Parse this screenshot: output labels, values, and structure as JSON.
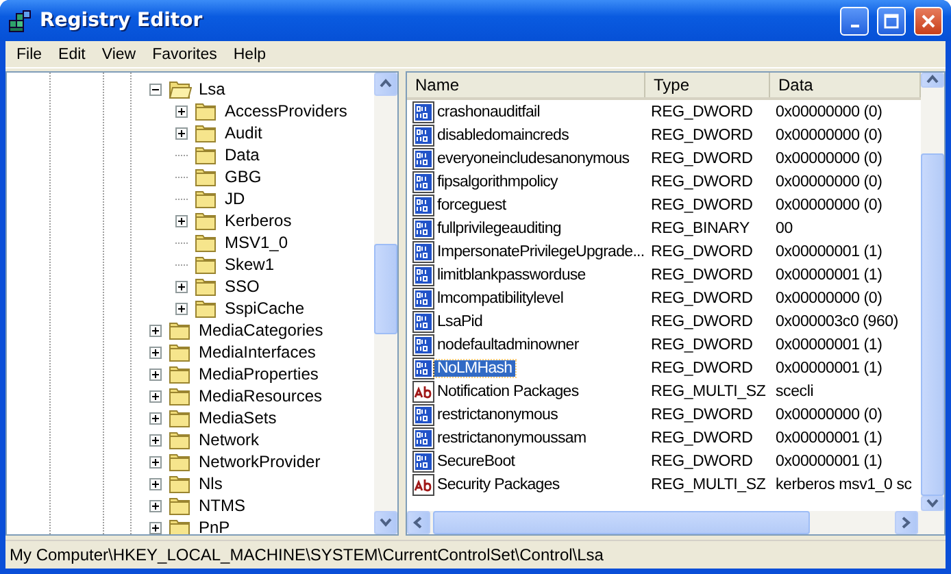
{
  "window": {
    "title": "Registry Editor"
  },
  "menu": [
    {
      "label": "File"
    },
    {
      "label": "Edit"
    },
    {
      "label": "View"
    },
    {
      "label": "Favorites"
    },
    {
      "label": "Help"
    }
  ],
  "tree": {
    "items": [
      {
        "label": "Lsa",
        "expandable": true,
        "expanded": true,
        "children": [
          {
            "label": "AccessProviders",
            "expandable": true,
            "expanded": false
          },
          {
            "label": "Audit",
            "expandable": true,
            "expanded": false
          },
          {
            "label": "Data",
            "expandable": false,
            "expanded": false
          },
          {
            "label": "GBG",
            "expandable": false,
            "expanded": false
          },
          {
            "label": "JD",
            "expandable": false,
            "expanded": false
          },
          {
            "label": "Kerberos",
            "expandable": true,
            "expanded": false
          },
          {
            "label": "MSV1_0",
            "expandable": false,
            "expanded": false
          },
          {
            "label": "Skew1",
            "expandable": false,
            "expanded": false
          },
          {
            "label": "SSO",
            "expandable": true,
            "expanded": false
          },
          {
            "label": "SspiCache",
            "expandable": true,
            "expanded": false
          }
        ]
      },
      {
        "label": "MediaCategories",
        "expandable": true,
        "expanded": false
      },
      {
        "label": "MediaInterfaces",
        "expandable": true,
        "expanded": false
      },
      {
        "label": "MediaProperties",
        "expandable": true,
        "expanded": false
      },
      {
        "label": "MediaResources",
        "expandable": true,
        "expanded": false
      },
      {
        "label": "MediaSets",
        "expandable": true,
        "expanded": false
      },
      {
        "label": "Network",
        "expandable": true,
        "expanded": false
      },
      {
        "label": "NetworkProvider",
        "expandable": true,
        "expanded": false
      },
      {
        "label": "Nls",
        "expandable": true,
        "expanded": false
      },
      {
        "label": "NTMS",
        "expandable": true,
        "expanded": false
      },
      {
        "label": "PnP",
        "expandable": true,
        "expanded": false
      }
    ]
  },
  "table": {
    "columns": [
      "Name",
      "Type",
      "Data"
    ],
    "rows": [
      {
        "kind": "binary",
        "name": "crashonauditfail",
        "type": "REG_DWORD",
        "data": "0x00000000 (0)",
        "selected": false
      },
      {
        "kind": "binary",
        "name": "disabledomaincreds",
        "type": "REG_DWORD",
        "data": "0x00000000 (0)",
        "selected": false
      },
      {
        "kind": "binary",
        "name": "everyoneincludesanonymous",
        "type": "REG_DWORD",
        "data": "0x00000000 (0)",
        "selected": false
      },
      {
        "kind": "binary",
        "name": "fipsalgorithmpolicy",
        "type": "REG_DWORD",
        "data": "0x00000000 (0)",
        "selected": false
      },
      {
        "kind": "binary",
        "name": "forceguest",
        "type": "REG_DWORD",
        "data": "0x00000000 (0)",
        "selected": false
      },
      {
        "kind": "binary",
        "name": "fullprivilegeauditing",
        "type": "REG_BINARY",
        "data": "00",
        "selected": false
      },
      {
        "kind": "binary",
        "name": "ImpersonatePrivilegeUpgrade...",
        "type": "REG_DWORD",
        "data": "0x00000001 (1)",
        "selected": false
      },
      {
        "kind": "binary",
        "name": "limitblankpassworduse",
        "type": "REG_DWORD",
        "data": "0x00000001 (1)",
        "selected": false
      },
      {
        "kind": "binary",
        "name": "lmcompatibilitylevel",
        "type": "REG_DWORD",
        "data": "0x00000000 (0)",
        "selected": false
      },
      {
        "kind": "binary",
        "name": "LsaPid",
        "type": "REG_DWORD",
        "data": "0x000003c0 (960)",
        "selected": false
      },
      {
        "kind": "binary",
        "name": "nodefaultadminowner",
        "type": "REG_DWORD",
        "data": "0x00000001 (1)",
        "selected": false
      },
      {
        "kind": "binary",
        "name": "NoLMHash",
        "type": "REG_DWORD",
        "data": "0x00000001 (1)",
        "selected": true
      },
      {
        "kind": "string",
        "name": "Notification Packages",
        "type": "REG_MULTI_SZ",
        "data": "scecli",
        "selected": false
      },
      {
        "kind": "binary",
        "name": "restrictanonymous",
        "type": "REG_DWORD",
        "data": "0x00000000 (0)",
        "selected": false
      },
      {
        "kind": "binary",
        "name": "restrictanonymoussam",
        "type": "REG_DWORD",
        "data": "0x00000001 (1)",
        "selected": false
      },
      {
        "kind": "binary",
        "name": "SecureBoot",
        "type": "REG_DWORD",
        "data": "0x00000001 (1)",
        "selected": false
      },
      {
        "kind": "string",
        "name": "Security Packages",
        "type": "REG_MULTI_SZ",
        "data": "kerberos msv1_0 sc",
        "selected": false
      }
    ]
  },
  "status_bar": "My Computer\\HKEY_LOCAL_MACHINE\\SYSTEM\\CurrentControlSet\\Control\\Lsa"
}
